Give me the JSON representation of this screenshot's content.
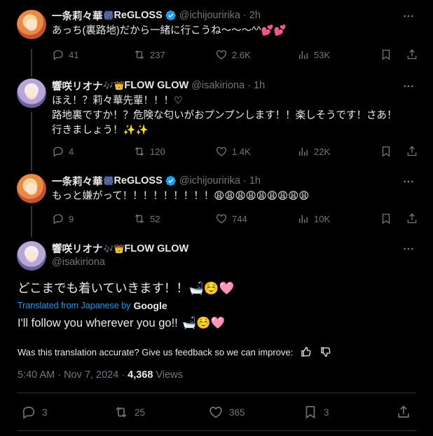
{
  "colors": {
    "background": "#000000",
    "text": "#e7e9ea",
    "muted": "#71767b",
    "accent": "#1d9bf0",
    "divider": "#2f3336"
  },
  "tweets": [
    {
      "name": "一条莉々華",
      "name_emoji": "🎆",
      "group": "ReGLOSS",
      "verified": true,
      "handle": "@ichijouririka",
      "time": "· 2h",
      "lines": [
        "あっち(裏路地)だから一緒に行こうね〜〜〜^^💕💕"
      ],
      "stats": {
        "replies": "41",
        "reposts": "237",
        "likes": "2.6K",
        "views": "53K"
      }
    },
    {
      "name": "響咲リオナ",
      "name_emoji": "🎶👑",
      "group": "FLOW GLOW",
      "verified": false,
      "handle": "@isakiriona",
      "time": "· 1h",
      "lines": [
        "ほえ！？莉々華先輩！！！♡",
        "路地裏ですか！？危険な匂いがおプンプンします！！楽しそうです！さあ！",
        "行きましょう！✨✨"
      ],
      "stats": {
        "replies": "4",
        "reposts": "120",
        "likes": "1.4K",
        "views": "22K"
      }
    },
    {
      "name": "一条莉々華",
      "name_emoji": "🎆",
      "group": "ReGLOSS",
      "verified": true,
      "handle": "@ichijouririka",
      "time": "· 1h",
      "lines": [
        "もっと嫌がって！！！！！！！！！😩😩😩😩😩😩😩😩😩"
      ],
      "stats": {
        "replies": "9",
        "reposts": "52",
        "likes": "744",
        "views": "10K"
      }
    }
  ],
  "main_tweet": {
    "name": "響咲リオナ",
    "name_emoji": "🎶👑",
    "group": "FLOW GLOW",
    "handle": "@isakiriona",
    "text": "どこまでも着いていきます！！",
    "text_emoji": "🛁☺️🩷",
    "translated_label": "Translated from Japanese by",
    "translator": "Google",
    "translation": "I'll follow you wherever you go!!",
    "translation_emoji": "🛁☺️🩷",
    "feedback": "Was this translation accurate? Give us feedback so we can improve:",
    "time": "5:40 AM · Nov 7, 2024 ·",
    "views_count": "4,368",
    "views_label": "Views",
    "stats": {
      "replies": "3",
      "reposts": "25",
      "likes": "365",
      "bookmarks": "3"
    }
  },
  "icons": [
    "verified-badge-icon",
    "more-icon",
    "reply-icon",
    "repost-icon",
    "like-icon",
    "views-icon",
    "bookmark-icon",
    "share-icon",
    "thumbs-up-icon",
    "thumbs-down-icon"
  ]
}
